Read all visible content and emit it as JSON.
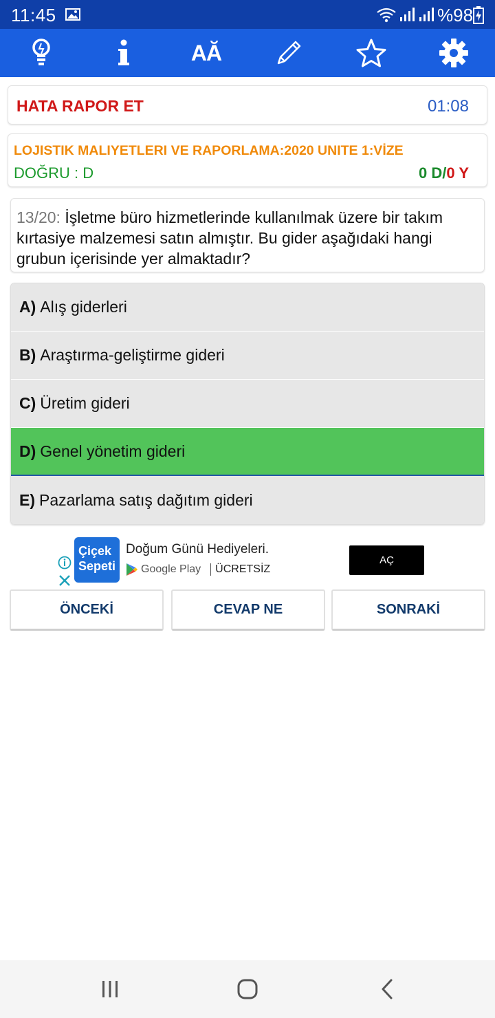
{
  "status_bar": {
    "time": "11:45",
    "battery": "%98",
    "icons": [
      "image-icon",
      "wifi-icon",
      "signal-icon",
      "signal-icon",
      "battery-charging-icon"
    ]
  },
  "toolbar": {
    "buttons": [
      {
        "name": "hint-bulb-icon"
      },
      {
        "name": "info-icon"
      },
      {
        "name": "font-size-icon",
        "label": "AĂ"
      },
      {
        "name": "pencil-icon"
      },
      {
        "name": "star-icon"
      },
      {
        "name": "gear-icon"
      }
    ]
  },
  "report": {
    "label": "HATA RAPOR ET",
    "timer": "01:08"
  },
  "course": {
    "title": "LOJISTIK MALIYETLERI VE RAPORLAMA:2020 UNITE 1:VİZE",
    "correct_answer": "DOĞRU : D",
    "score_correct": "0 D/",
    "score_wrong": "0 Y"
  },
  "question": {
    "number": "13/20:",
    "text": " İşletme büro hizmetlerinde kullanılmak üzere bir takım kırtasiye malzemesi satın almıştır. Bu gider aşağıdaki hangi grubun içerisinde yer almaktadır?"
  },
  "options": [
    {
      "letter": "A)",
      "text": "Alış giderleri"
    },
    {
      "letter": "B)",
      "text": "Araştırma-geliştirme gideri"
    },
    {
      "letter": "C)",
      "text": "Üretim gideri"
    },
    {
      "letter": "D)",
      "text": "Genel yönetim gideri"
    },
    {
      "letter": "E)",
      "text": "Pazarlama satış dağıtım gideri"
    }
  ],
  "ad": {
    "logo_line1": "Çiçek",
    "logo_line2": "Sepeti",
    "title": "Doğum Günü Hediyeleri.",
    "store": "Google Play",
    "price": "ÜCRETSİZ",
    "cta": "AÇ"
  },
  "navigation": {
    "prev": "ÖNCEKİ",
    "answer": "CEVAP NE",
    "next": "SONRAKİ"
  },
  "colors": {
    "status_bar": "#0f3fa8",
    "toolbar": "#1a5fe0",
    "report_red": "#d01818",
    "course_orange": "#f08a0a",
    "correct_green": "#52c45a",
    "nav_text": "#123a6b"
  }
}
